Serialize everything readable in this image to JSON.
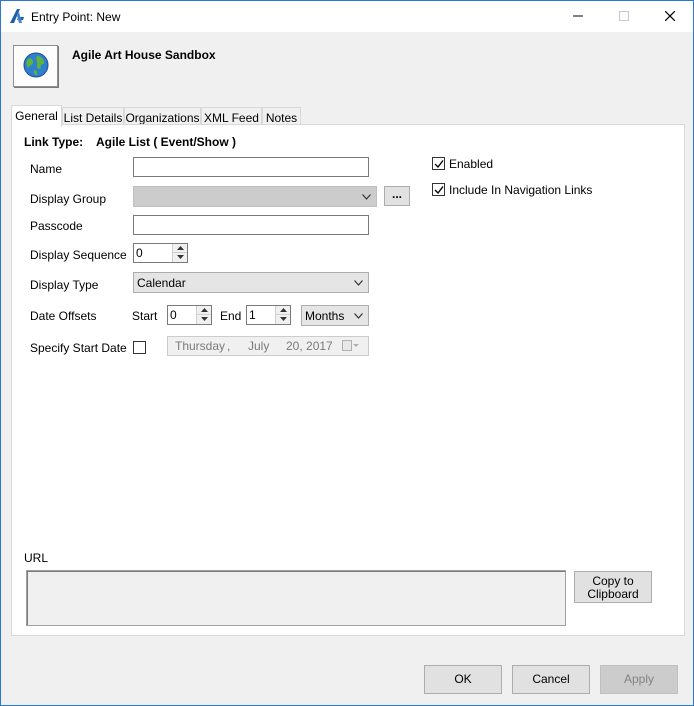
{
  "window": {
    "title": "Entry Point: New",
    "app_icon": "agile-logo-icon",
    "controls": {
      "minimize": "minimize-icon",
      "maximize": "maximize-icon",
      "close": "close-icon"
    }
  },
  "header": {
    "org_name": "Agile Art House Sandbox",
    "icon": "globe-icon"
  },
  "tabs": [
    {
      "label": "General",
      "active": true
    },
    {
      "label": "List Details",
      "active": false
    },
    {
      "label": "Organizations",
      "active": false
    },
    {
      "label": "XML Feed",
      "active": false
    },
    {
      "label": "Notes",
      "active": false
    }
  ],
  "general": {
    "link_type_label": "Link Type:",
    "link_type_value": "Agile List ( Event/Show )",
    "name_label": "Name",
    "name_value": "",
    "display_group_label": "Display Group",
    "display_group_value": "",
    "ellipsis_label": "...",
    "passcode_label": "Passcode",
    "passcode_value": "",
    "display_sequence_label": "Display Sequence",
    "display_sequence_value": "0",
    "display_type_label": "Display Type",
    "display_type_value": "Calendar",
    "date_offsets_label": "Date Offsets",
    "start_label": "Start",
    "start_value": "0",
    "end_label": "End",
    "end_value": "1",
    "offset_unit_value": "Months",
    "specify_start_date_label": "Specify Start Date",
    "specify_start_date_checked": false,
    "date": {
      "weekday": "Thursday",
      "sep": ",",
      "month": "July",
      "day_year": "20, 2017"
    },
    "enabled_label": "Enabled",
    "enabled_checked": true,
    "include_nav_label": "Include In Navigation Links",
    "include_nav_checked": true,
    "url_label": "URL",
    "url_value": "",
    "copy_button_label": "Copy to Clipboard"
  },
  "footer": {
    "ok_label": "OK",
    "cancel_label": "Cancel",
    "apply_label": "Apply"
  },
  "colors": {
    "window_border": "#2b79d0",
    "logo_blue": "#1e5fa8"
  }
}
